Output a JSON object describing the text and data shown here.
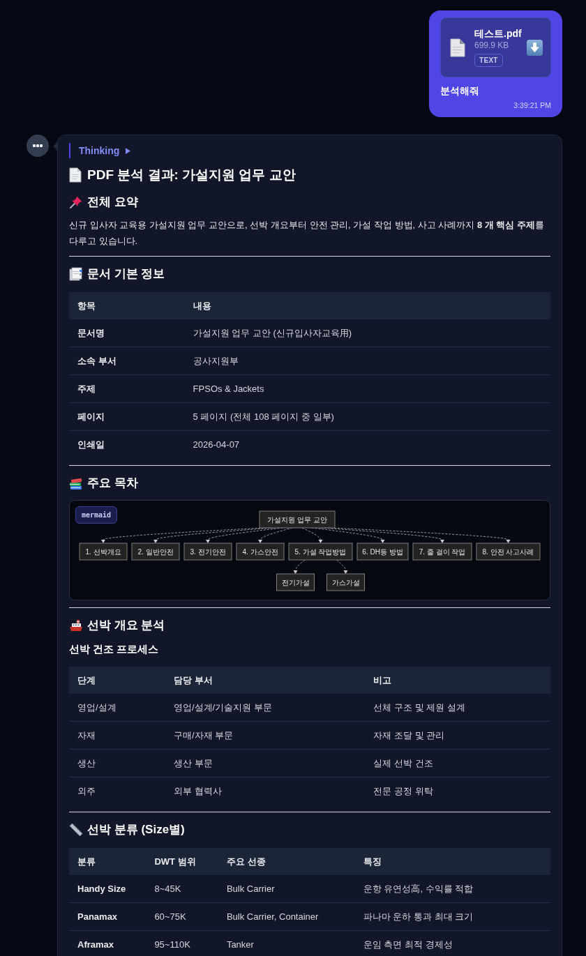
{
  "user_message": {
    "attachment": {
      "name": "테스트.pdf",
      "size": "699.9 KB",
      "badge": "TEXT"
    },
    "text": "분석해줘",
    "time": "3:39:21 PM"
  },
  "assistant_message": {
    "thinking": {
      "label": "Thinking",
      "expanded": false
    },
    "title": "PDF 분석 결과: 가설지원 업무 교안",
    "sections": [
      {
        "kind": "summary",
        "heading": "전체 요약",
        "paragraph": "신규 입사자 교육용 가설지원 업무 교안으로, 선박 개요부터 안전 관리, 가설 작업 방법, 사고 사례까지 **8 개 핵심 주제**를 다루고 있습니다."
      },
      {
        "kind": "table",
        "heading": "문서 기본 정보",
        "table": {
          "bold_first_column": true,
          "columns": [
            "항목",
            "내용"
          ],
          "rows": [
            [
              "문서명",
              "가설지원 업무 교안 (신규입사자교육用)"
            ],
            [
              "소속 부서",
              "공사지원부"
            ],
            [
              "주제",
              "FPSOs & Jackets"
            ],
            [
              "페이지",
              "5 페이지 (전체 108 페이지 중 일부)"
            ],
            [
              "인쇄일",
              "2026-04-07"
            ]
          ]
        }
      },
      {
        "kind": "diagram",
        "heading": "주요 목차",
        "diagram": {
          "badge": "mermaid",
          "root": {
            "label": "가설지원 업무 교안",
            "children": [
              {
                "label": "1. 선박개요"
              },
              {
                "label": "2. 일반안전"
              },
              {
                "label": "3. 전기안전"
              },
              {
                "label": "4. 가스안전"
              },
              {
                "label": "5. 가설 작업방법",
                "children": [
                  {
                    "label": "전기가설"
                  },
                  {
                    "label": "가스가설"
                  }
                ]
              },
              {
                "label": "6. DH등 방법"
              },
              {
                "label": "7. 줄 걸이 작업"
              },
              {
                "label": "8. 안전 사고사례"
              }
            ]
          }
        }
      },
      {
        "kind": "table",
        "heading": "선박 개요 분석",
        "subheading": "선박 건조 프로세스",
        "table": {
          "bold_first_column": false,
          "columns": [
            "단계",
            "담당 부서",
            "비고"
          ],
          "rows": [
            [
              "영업/설계",
              "영업/설계/기술지원 부문",
              "선체 구조 및 제원 설계"
            ],
            [
              "자재",
              "구매/자재 부문",
              "자재 조달 및 관리"
            ],
            [
              "생산",
              "생산 부문",
              "실제 선박 건조"
            ],
            [
              "외주",
              "외부 협력사",
              "전문 공정 위탁"
            ]
          ]
        }
      },
      {
        "kind": "table",
        "heading": "선박 분류 (Size별)",
        "table": {
          "bold_first_column": true,
          "columns": [
            "분류",
            "DWT 범위",
            "주요 선종",
            "특징"
          ],
          "rows": [
            [
              "Handy Size",
              "8~45K",
              "Bulk Carrier",
              "운항 유연성高, 수익률 적합"
            ],
            [
              "Panamax",
              "60~75K",
              "Bulk Carrier, Container",
              "파나마 운하 통과 최대 크기"
            ],
            [
              "Aframax",
              "95~110K",
              "Tanker",
              "운임 측면 최적 경제성"
            ]
          ]
        }
      }
    ]
  }
}
